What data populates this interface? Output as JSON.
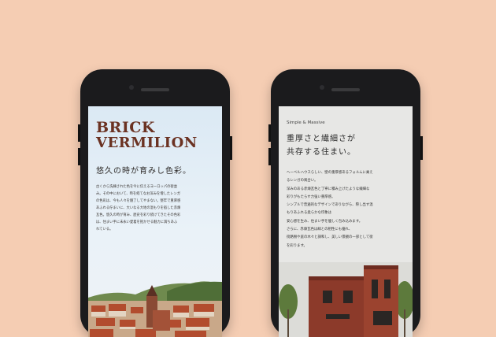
{
  "left_phone": {
    "brand_line1": "BRICK",
    "brand_line2": "VERMILION",
    "tagline": "悠久の時が育みし色彩。",
    "body": "古くから洗練された色を今に伝えるヨーロッパの街並\nみ。その中において、時を経てなお深みを増したレンガ\nの色彩は、今も人々を魅了してやまない。堅牢で重厚感\nあふれる佇まいに、大いなる大地の温もりを宿した赤煉\n瓦色。悠久の時が育み、歴史を彩り続けてきたその色彩\nは、住まい手に末永い愛着を抱かせる魅力に満ちあふ\nれている。"
  },
  "right_phone": {
    "eyebrow": "Simple & Massive",
    "title": "重厚さと繊細さが\n共存する住まい。",
    "body": "ヘーベルハウスらしい、壁の重厚感あるフォルムに乗え\nるレンガの風合い。\n深みのある赤煉瓦色と丁寧に積み上げたような繊細な\n彩りがもたらす力強い重厚感。\nシンプルで普遍的なデザインでありながら、際し出す温\nもりあふれる柔らかな印象は\n安心感を生み、住まい手を優しく包み込みます。\nさらに、赤煉瓦色は緑との相性にも優れ、\n街路樹や庭の木々と調和し、美しい景観の一部として街\nを彩ります。"
  },
  "colors": {
    "background": "#f5cdb3",
    "brand": "#6b3222",
    "phone_frame": "#1b1b1d"
  }
}
